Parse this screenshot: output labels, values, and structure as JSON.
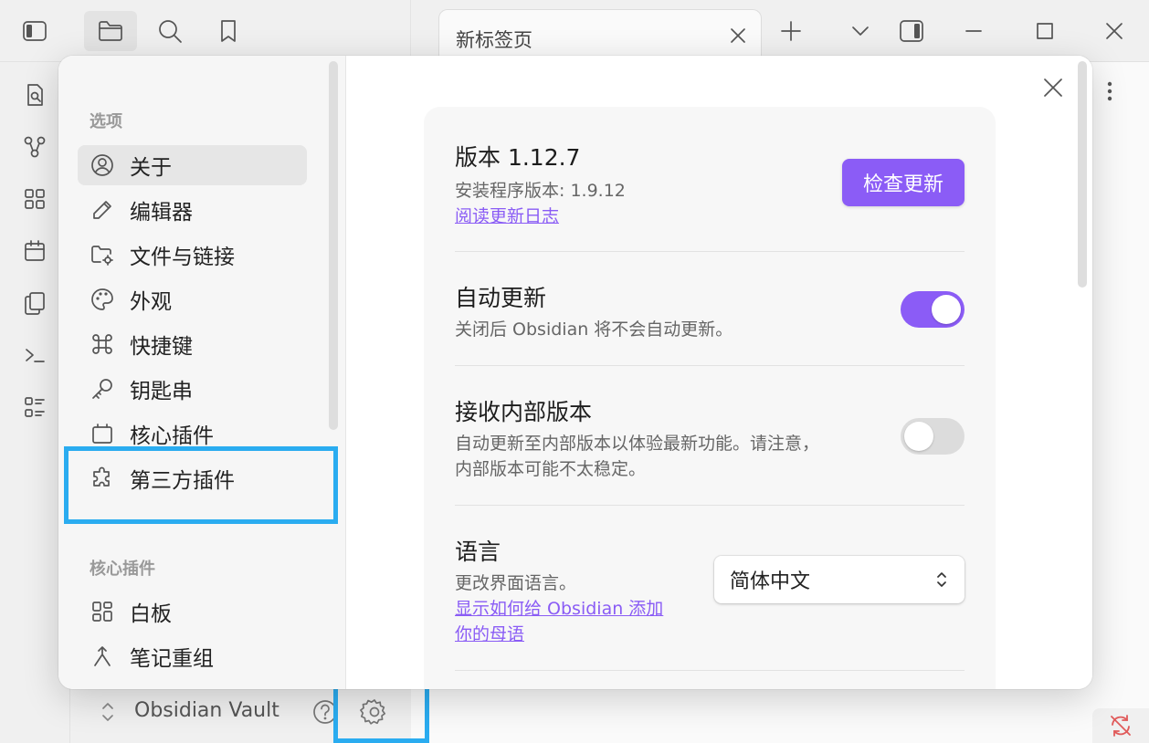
{
  "window": {
    "tab_title": "新标签页"
  },
  "vault": {
    "name": "Obsidian Vault"
  },
  "settings": {
    "nav": {
      "section_options": "选项",
      "items": [
        {
          "label": "关于",
          "icon": "user-circle-icon"
        },
        {
          "label": "编辑器",
          "icon": "pencil-icon"
        },
        {
          "label": "文件与链接",
          "icon": "folder-cog-icon"
        },
        {
          "label": "外观",
          "icon": "palette-icon"
        },
        {
          "label": "快捷键",
          "icon": "command-icon"
        },
        {
          "label": "钥匙串",
          "icon": "key-icon"
        },
        {
          "label": "核心插件",
          "icon": "plug-box-icon"
        },
        {
          "label": "第三方插件",
          "icon": "puzzle-icon"
        }
      ],
      "section_core": "核心插件",
      "core_items": [
        {
          "label": "白板",
          "icon": "layout-grid-icon"
        },
        {
          "label": "笔记重组",
          "icon": "merge-icon"
        }
      ],
      "active_item": "关于"
    },
    "about": {
      "version_title": "版本 1.12.7",
      "installer_version": "安装程序版本: 1.9.12",
      "changelog_link": "阅读更新日志",
      "check_update_button": "检查更新",
      "auto_update": {
        "title": "自动更新",
        "desc": "关闭后 Obsidian 将不会自动更新。",
        "enabled": true
      },
      "insider": {
        "title": "接收内部版本",
        "desc_line1": "自动更新至内部版本以体验最新功能。请注意，",
        "desc_line2": "内部版本可能不太稳定。",
        "enabled": false
      },
      "language": {
        "title": "语言",
        "desc": "更改界面语言。",
        "link_line1": "显示如何给 Obsidian 添加",
        "link_line2": "你的母语",
        "selected": "简体中文"
      }
    }
  },
  "colors": {
    "accent": "#8b5cf6",
    "highlight": "#2aacf0"
  }
}
